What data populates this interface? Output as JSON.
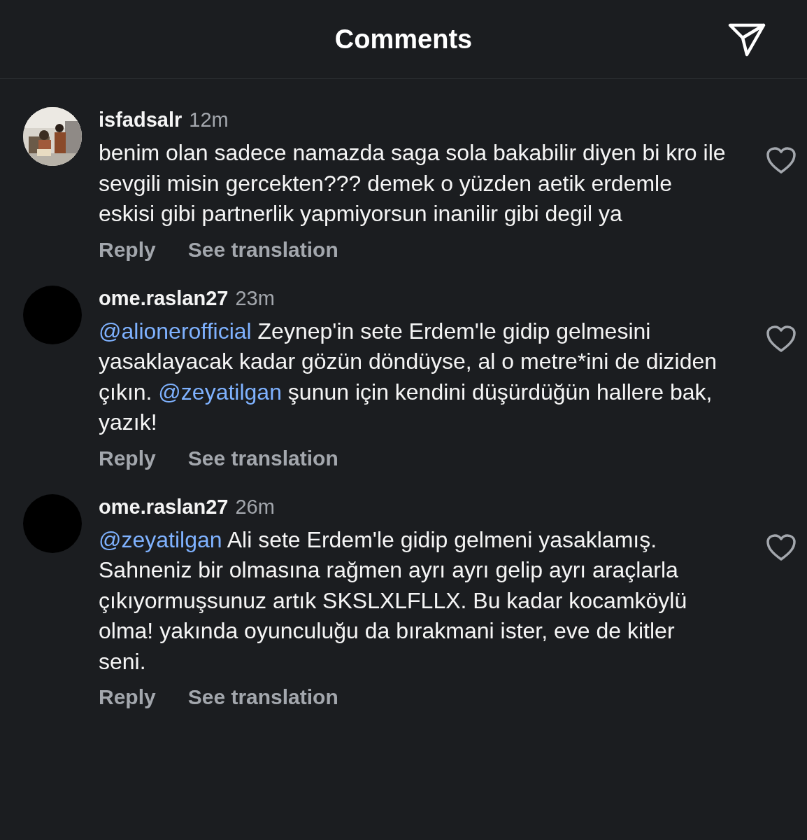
{
  "header": {
    "title": "Comments"
  },
  "comments": [
    {
      "avatar": {
        "kind": "picture"
      },
      "username": "isfadsalr",
      "time": "12m",
      "body": [
        {
          "kind": "text",
          "text": "benim olan sadece namazda saga sola bakabilir diyen bi kro ile sevgili misin gercekten??? demek o yüzden aetik erdemle eskisi gibi partnerlik yapmiyorsun inanilir gibi degil ya"
        }
      ],
      "liked": false,
      "actions": [
        "Reply",
        "See translation"
      ]
    },
    {
      "avatar": {
        "kind": "blank"
      },
      "username": "ome.raslan27",
      "time": "23m",
      "body": [
        {
          "kind": "mention",
          "text": "@alionerofficial"
        },
        {
          "kind": "text",
          "text": " Zeynep'in sete Erdem'le gidip gelmesini yasaklayacak kadar gözün döndüyse, al o metre*ini de diziden çıkın. "
        },
        {
          "kind": "mention",
          "text": "@zeyatilgan"
        },
        {
          "kind": "text",
          "text": " şunun için kendini düşürdüğün hallere bak, yazık!"
        }
      ],
      "liked": false,
      "actions": [
        "Reply",
        "See translation"
      ]
    },
    {
      "avatar": {
        "kind": "blank"
      },
      "username": "ome.raslan27",
      "time": "26m",
      "body": [
        {
          "kind": "mention",
          "text": "@zeyatilgan"
        },
        {
          "kind": "text",
          "text": " Ali sete Erdem'le gidip gelmeni yasaklamış. Sahneniz bir olmasına rağmen ayrı ayrı gelip ayrı araçlarla çıkıyormuşsunuz artık SKSLXLFLLX. Bu kadar kocamköylü olma! yakında oyunculuğu da bırakmani ister, eve de kitler seni."
        }
      ],
      "liked": false,
      "actions": [
        "Reply",
        "See translation"
      ]
    }
  ]
}
